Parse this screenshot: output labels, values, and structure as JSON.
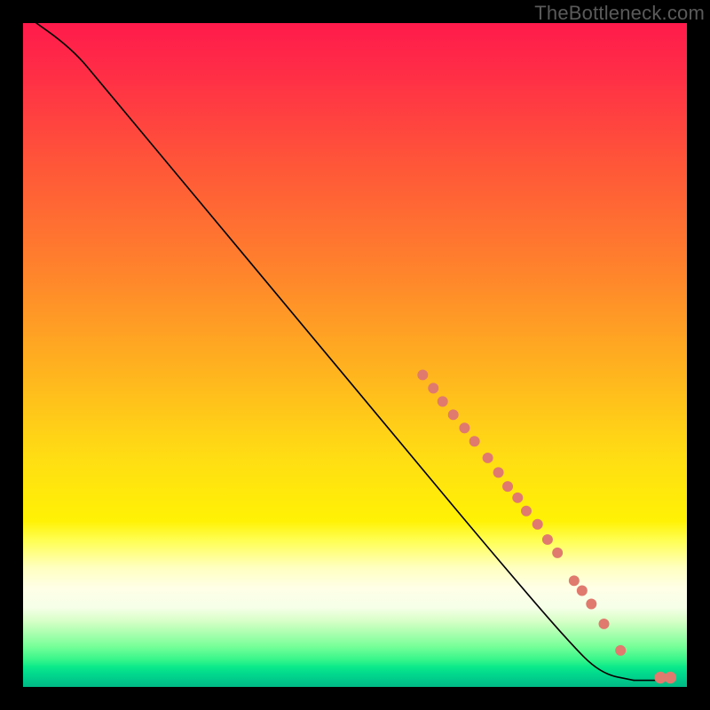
{
  "watermark": "TheBottleneck.com",
  "colors": {
    "point": "#e07a6e",
    "curve": "#000000"
  },
  "chart_data": {
    "type": "scatter",
    "title": "",
    "xlabel": "",
    "ylabel": "",
    "xlim": [
      0,
      1000
    ],
    "ylim": [
      0,
      1000
    ],
    "background_gradient": [
      {
        "stop": 0.0,
        "color": "#ff1a4b"
      },
      {
        "stop": 0.5,
        "color": "#ffb21f"
      },
      {
        "stop": 0.75,
        "color": "#fff205"
      },
      {
        "stop": 0.88,
        "color": "#ffffe0"
      },
      {
        "stop": 1.0,
        "color": "#00c98a"
      }
    ],
    "curve": [
      {
        "x": 20,
        "y": 1000
      },
      {
        "x": 55,
        "y": 975
      },
      {
        "x": 85,
        "y": 948
      },
      {
        "x": 110,
        "y": 918
      },
      {
        "x": 150,
        "y": 870
      },
      {
        "x": 250,
        "y": 750
      },
      {
        "x": 400,
        "y": 570
      },
      {
        "x": 550,
        "y": 390
      },
      {
        "x": 700,
        "y": 210
      },
      {
        "x": 820,
        "y": 70
      },
      {
        "x": 870,
        "y": 20
      },
      {
        "x": 920,
        "y": 10
      }
    ],
    "tail_segment": [
      {
        "x": 920,
        "y": 10
      },
      {
        "x": 965,
        "y": 10
      }
    ],
    "points": [
      {
        "x": 602,
        "y": 470,
        "r": 8
      },
      {
        "x": 618,
        "y": 450,
        "r": 8
      },
      {
        "x": 632,
        "y": 430,
        "r": 8
      },
      {
        "x": 648,
        "y": 410,
        "r": 8
      },
      {
        "x": 665,
        "y": 390,
        "r": 8
      },
      {
        "x": 680,
        "y": 370,
        "r": 8
      },
      {
        "x": 700,
        "y": 345,
        "r": 8
      },
      {
        "x": 716,
        "y": 323,
        "r": 8
      },
      {
        "x": 730,
        "y": 302,
        "r": 8
      },
      {
        "x": 745,
        "y": 285,
        "r": 8
      },
      {
        "x": 758,
        "y": 265,
        "r": 8
      },
      {
        "x": 775,
        "y": 245,
        "r": 8
      },
      {
        "x": 790,
        "y": 222,
        "r": 8
      },
      {
        "x": 805,
        "y": 202,
        "r": 8
      },
      {
        "x": 830,
        "y": 160,
        "r": 8
      },
      {
        "x": 842,
        "y": 145,
        "r": 8
      },
      {
        "x": 856,
        "y": 125,
        "r": 8
      },
      {
        "x": 875,
        "y": 95,
        "r": 8
      },
      {
        "x": 900,
        "y": 55,
        "r": 8
      },
      {
        "x": 960,
        "y": 14,
        "r": 9
      },
      {
        "x": 975,
        "y": 14,
        "r": 9
      }
    ]
  }
}
